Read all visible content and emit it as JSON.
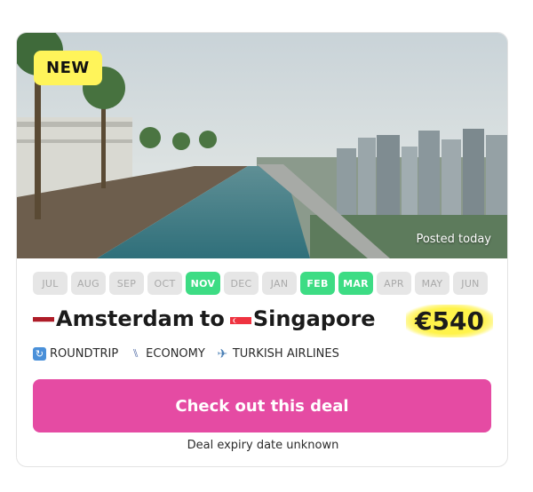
{
  "badge": {
    "label": "NEW",
    "color": "#fff45a"
  },
  "hero": {
    "posted_label": "Posted today"
  },
  "months": [
    {
      "label": "JUL",
      "active": false
    },
    {
      "label": "AUG",
      "active": false
    },
    {
      "label": "SEP",
      "active": false
    },
    {
      "label": "OCT",
      "active": false
    },
    {
      "label": "NOV",
      "active": true
    },
    {
      "label": "DEC",
      "active": false
    },
    {
      "label": "JAN",
      "active": false
    },
    {
      "label": "FEB",
      "active": true
    },
    {
      "label": "MAR",
      "active": true
    },
    {
      "label": "APR",
      "active": false
    },
    {
      "label": "MAY",
      "active": false
    },
    {
      "label": "JUN",
      "active": false
    }
  ],
  "route": {
    "origin": "Amsterdam",
    "connector": "to",
    "destination": "Singapore",
    "origin_flag_icon": "netherlands-flag-icon",
    "destination_flag_icon": "singapore-flag-icon"
  },
  "price": {
    "label": "€540",
    "highlight_color": "#fff34a"
  },
  "meta": {
    "trip_type": "ROUNDTRIP",
    "trip_type_icon": "repeat-icon",
    "cabin": "ECONOMY",
    "cabin_icon": "seat-icon",
    "airline": "TURKISH AIRLINES",
    "airline_icon": "airplane-icon"
  },
  "cta": {
    "label": "Check out this deal",
    "color": "#e54ba3"
  },
  "expiry": "Deal expiry date unknown",
  "colors": {
    "active_month": "#3ddc84",
    "inactive_month": "#e6e6e6"
  }
}
